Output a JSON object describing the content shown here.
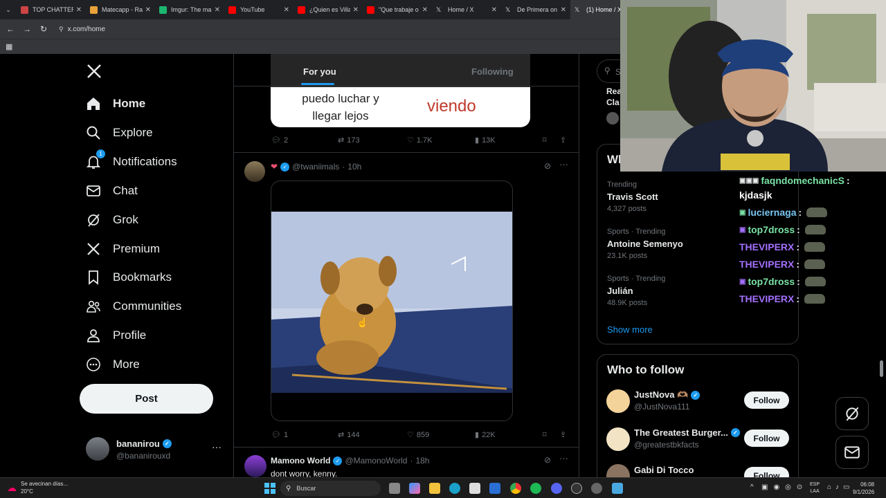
{
  "browser": {
    "tabs": [
      {
        "title": "TOP CHATTERS",
        "color": "#c44"
      },
      {
        "title": "Matecapp - Ra",
        "color": "#e9a33a"
      },
      {
        "title": "Imgur: The ma",
        "color": "#1bb76e"
      },
      {
        "title": "YouTube",
        "color": "#f00"
      },
      {
        "title": "¿Quien es Villa",
        "color": "#f00"
      },
      {
        "title": "\"Que trabaje o",
        "color": "#f00"
      },
      {
        "title": "Home / X",
        "color": "#fff"
      },
      {
        "title": "De Primera on",
        "color": "#fff"
      },
      {
        "title": "(1) Home / X",
        "color": "#fff"
      }
    ],
    "url": "x.com/home"
  },
  "nav": {
    "items": [
      {
        "label": "Home",
        "icon": "home-icon"
      },
      {
        "label": "Explore",
        "icon": "search-icon"
      },
      {
        "label": "Notifications",
        "icon": "bell-icon",
        "badge": "1"
      },
      {
        "label": "Chat",
        "icon": "mail-icon"
      },
      {
        "label": "Grok",
        "icon": "grok-icon"
      },
      {
        "label": "Premium",
        "icon": "x-logo-icon"
      },
      {
        "label": "Bookmarks",
        "icon": "bookmark-icon"
      },
      {
        "label": "Communities",
        "icon": "people-icon"
      },
      {
        "label": "Profile",
        "icon": "person-icon"
      },
      {
        "label": "More",
        "icon": "more-circle-icon"
      }
    ],
    "post_label": "Post",
    "account": {
      "name": "bananirou",
      "handle": "@bananirouxd"
    }
  },
  "feed": {
    "tabs": {
      "for_you": "For you",
      "following": "Following"
    },
    "post1": {
      "image_text_left": [
        "puedo luchar y",
        "llegar lejos"
      ],
      "image_text_right": "viendo",
      "stats": {
        "replies": "2",
        "reposts": "173",
        "likes": "1.7K",
        "views": "13K"
      }
    },
    "post2": {
      "handle": "@twaniimals",
      "time": "10h",
      "stats": {
        "replies": "1",
        "reposts": "144",
        "likes": "859",
        "views": "22K"
      }
    },
    "post3": {
      "name": "Mamono World",
      "handle": "@MamonoWorld",
      "time": "18h",
      "text": "dont worry, kenny."
    }
  },
  "sidebar": {
    "search_placeholder": "S",
    "trending_title": "Wh",
    "trends": [
      {
        "category": "Trending",
        "name": "Travis Scott",
        "posts": "4,327 posts"
      },
      {
        "category": "Sports · Trending",
        "name": "Antoine Semenyo",
        "posts": "23.1K posts"
      },
      {
        "category": "Sports · Trending",
        "name": "Julián",
        "posts": "48.9K posts"
      }
    ],
    "show_more": "Show more",
    "who_to_follow_title": "Who to follow",
    "follow_suggestions": [
      {
        "name": "JustNova 🫶🏽",
        "handle": "@JustNova111",
        "button": "Follow"
      },
      {
        "name": "The Greatest Burger...",
        "handle": "@greatestbkfacts",
        "button": "Follow"
      },
      {
        "name": "Gabi Di Tocco",
        "handle": "",
        "button": "Follow"
      }
    ],
    "top_partial": [
      "Rea",
      "Cla"
    ]
  },
  "stream_chat": [
    {
      "user": "faqndomechanicS",
      "color": "#7be3a5",
      "message": "kjdasjk"
    },
    {
      "user": "luciernaga",
      "color": "#79c5f0",
      "message": ""
    },
    {
      "user": "top7dross",
      "color": "#7be3a5",
      "message": ""
    },
    {
      "user": "THEVIPERX",
      "color": "#a470ff",
      "message": ""
    },
    {
      "user": "THEVIPERX",
      "color": "#a470ff",
      "message": ""
    },
    {
      "user": "top7dross",
      "color": "#7be3a5",
      "message": ""
    },
    {
      "user": "THEVIPERX",
      "color": "#a470ff",
      "message": ""
    }
  ],
  "taskbar": {
    "weather_text": "Se avecinan días...",
    "temperature": "20°C",
    "search_label": "Buscar",
    "lang": "ESP",
    "lang2": "LAA",
    "time": "06:08",
    "date": "9/1/2026"
  },
  "colors": {
    "accent": "#1d9bf0",
    "bg": "#000000",
    "border": "#2f3336"
  }
}
